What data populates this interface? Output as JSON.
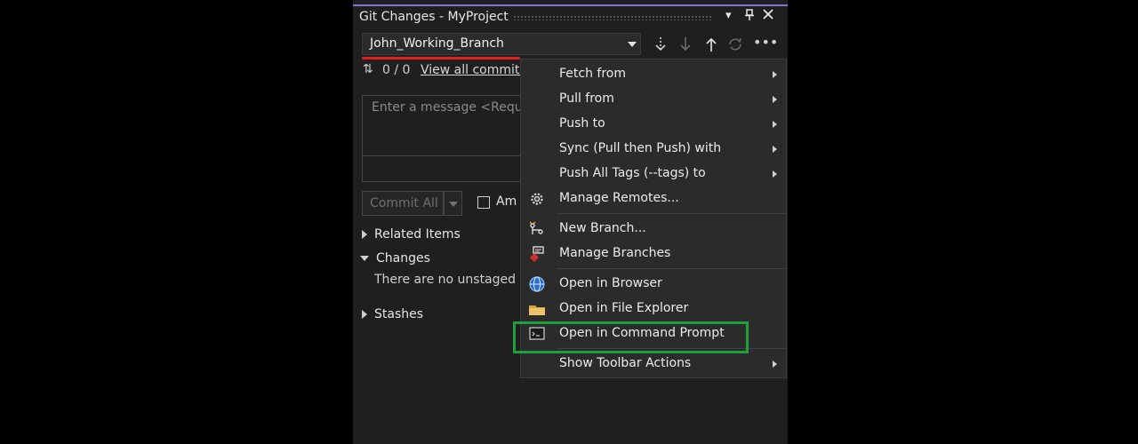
{
  "panel": {
    "title": "Git Changes - MyProject",
    "branch": "John_Working_Branch",
    "counts": "0 / 0",
    "view_all_commits": "View all commits",
    "message_placeholder": "Enter a message <Requir",
    "commit_all": "Commit All",
    "amend_label": "Am",
    "sections": {
      "related_items": "Related Items",
      "changes": "Changes",
      "no_changes_text": "There are no unstaged ch",
      "stashes": "Stashes"
    }
  },
  "menu": {
    "items": [
      {
        "label": "Fetch from",
        "submenu": true
      },
      {
        "label": "Pull from",
        "submenu": true
      },
      {
        "label": "Push to",
        "submenu": true
      },
      {
        "label": "Sync (Pull then Push) with",
        "submenu": true
      },
      {
        "label": "Push All Tags (--tags) to",
        "submenu": true
      },
      {
        "label": "Manage Remotes...",
        "icon": "gear-icon"
      },
      {
        "label": "New Branch...",
        "icon": "new-branch-icon"
      },
      {
        "label": "Manage Branches",
        "icon": "manage-branches-icon"
      },
      {
        "label": "Open in Browser",
        "icon": "globe-icon"
      },
      {
        "label": "Open in File Explorer",
        "icon": "folder-icon"
      },
      {
        "label": "Open in Command Prompt",
        "icon": "command-prompt-icon"
      },
      {
        "label": "Show Toolbar Actions",
        "submenu": true
      }
    ]
  },
  "colors": {
    "branch_underline": "#e0201c",
    "highlight_box": "#1ea03c",
    "panel_accent": "#8a6fd6"
  }
}
